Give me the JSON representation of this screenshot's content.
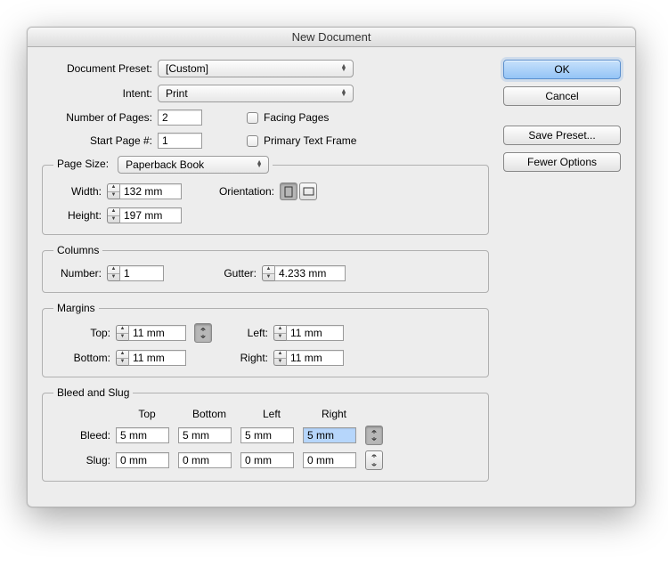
{
  "title": "New Document",
  "preset": {
    "label": "Document Preset:",
    "value": "[Custom]"
  },
  "intent": {
    "label": "Intent:",
    "value": "Print"
  },
  "pages": {
    "label": "Number of Pages:",
    "value": "2"
  },
  "startPage": {
    "label": "Start Page #:",
    "value": "1"
  },
  "facingPages": {
    "label": "Facing Pages",
    "checked": false
  },
  "primaryTextFrame": {
    "label": "Primary Text Frame",
    "checked": false
  },
  "pageSize": {
    "legend": "Page Size:",
    "preset": "Paperback Book",
    "width": {
      "label": "Width:",
      "value": "132 mm"
    },
    "height": {
      "label": "Height:",
      "value": "197 mm"
    },
    "orientation": {
      "label": "Orientation:",
      "portrait": true
    }
  },
  "columns": {
    "legend": "Columns",
    "number": {
      "label": "Number:",
      "value": "1"
    },
    "gutter": {
      "label": "Gutter:",
      "value": "4.233 mm"
    }
  },
  "margins": {
    "legend": "Margins",
    "top": {
      "label": "Top:",
      "value": "11 mm"
    },
    "bottom": {
      "label": "Bottom:",
      "value": "11 mm"
    },
    "left": {
      "label": "Left:",
      "value": "11 mm"
    },
    "right": {
      "label": "Right:",
      "value": "11 mm"
    },
    "linked": true
  },
  "bleedSlug": {
    "legend": "Bleed and Slug",
    "headers": {
      "top": "Top",
      "bottom": "Bottom",
      "left": "Left",
      "right": "Right"
    },
    "bleed": {
      "label": "Bleed:",
      "top": "5 mm",
      "bottom": "5 mm",
      "left": "5 mm",
      "right": "5 mm",
      "linked": true
    },
    "slug": {
      "label": "Slug:",
      "top": "0 mm",
      "bottom": "0 mm",
      "left": "0 mm",
      "right": "0 mm",
      "linked": false
    }
  },
  "buttons": {
    "ok": "OK",
    "cancel": "Cancel",
    "savePreset": "Save Preset...",
    "fewerOptions": "Fewer Options"
  }
}
